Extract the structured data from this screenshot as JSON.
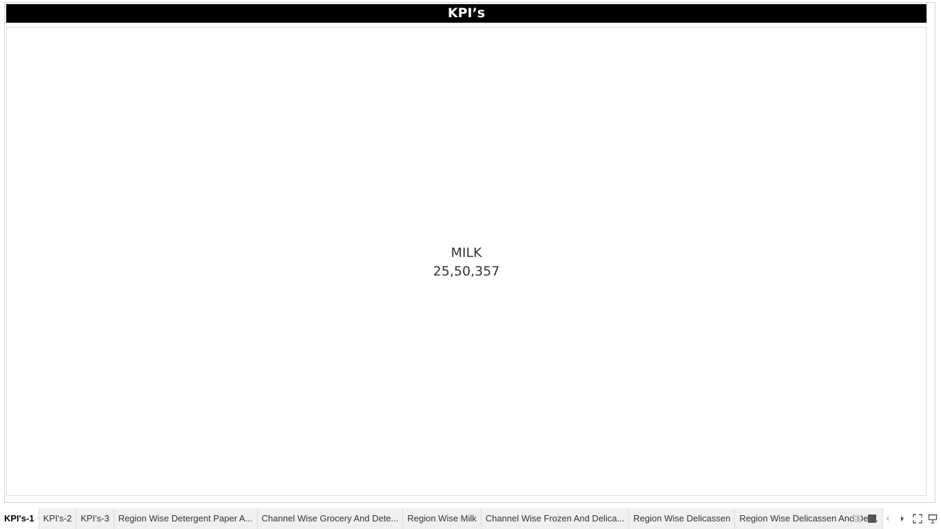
{
  "dashboard": {
    "title": "KPI’s",
    "kpi": {
      "label": "MILK",
      "value": "25,50,357"
    }
  },
  "tabs": [
    {
      "label": "KPI's-1",
      "active": true
    },
    {
      "label": "KPI's-2",
      "active": false
    },
    {
      "label": "KPI's-3",
      "active": false
    },
    {
      "label": "Region Wise Detergent Paper A...",
      "active": false
    },
    {
      "label": "Channel Wise Grocery And Dete...",
      "active": false
    },
    {
      "label": "Region Wise Milk",
      "active": false
    },
    {
      "label": "Channel Wise Frozen And Delica...",
      "active": false
    },
    {
      "label": "Region Wise Delicassen",
      "active": false
    },
    {
      "label": "Region Wise Delicassen And Det...",
      "active": false
    }
  ],
  "controls": {
    "icons": [
      "sheet-list-icon",
      "filmstrip-icon",
      "prev-sheet-icon",
      "next-sheet-icon",
      "fullscreen-icon",
      "presentation-mode-icon"
    ]
  },
  "colors": {
    "title_bg": "#000000",
    "title_text": "#ffffff",
    "kpi_text": "#333333",
    "active_tab_bg": "#ffffff",
    "inactive_tab_bg": "#f0f0f0"
  }
}
